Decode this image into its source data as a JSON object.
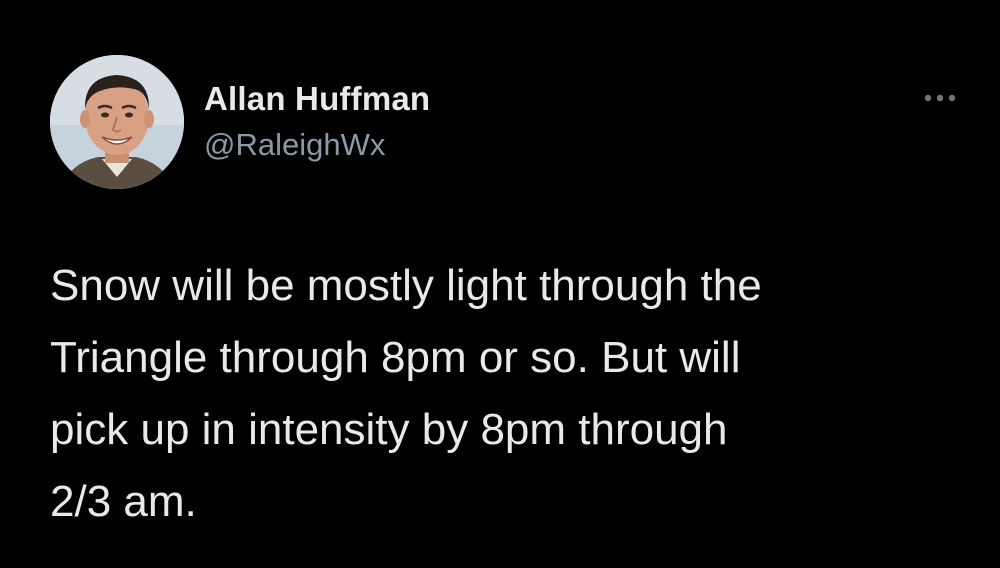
{
  "tweet": {
    "author": {
      "display_name": "Allan Huffman",
      "handle": "@RaleighWx",
      "avatar": "profile-photo"
    },
    "more_icon": "ellipsis-horizontal-icon",
    "text_lines": [
      "Snow will be mostly light through the",
      "Triangle through 8pm or so. But will",
      "pick up in intensity by 8pm through",
      "2/3 am."
    ]
  },
  "colors": {
    "background": "#000000",
    "primary_text": "#e7e9ea",
    "secondary_text": "#8b98a5"
  }
}
